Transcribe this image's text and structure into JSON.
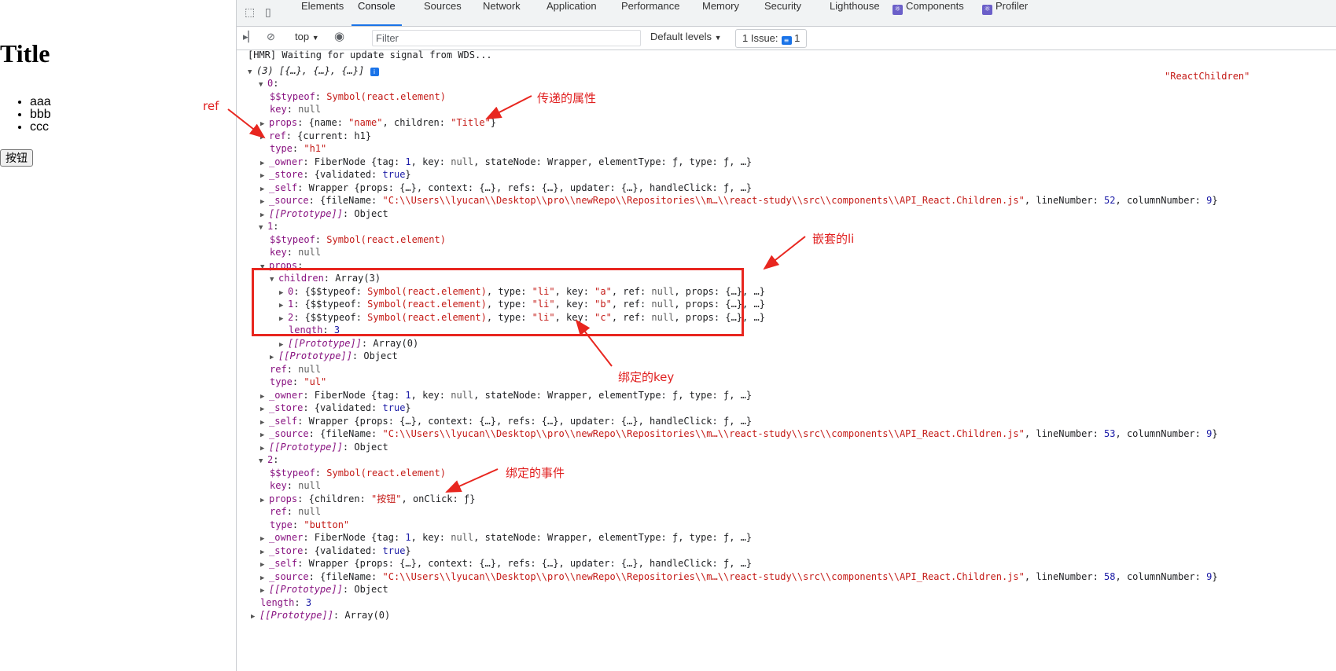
{
  "page": {
    "title": "Title",
    "list": [
      "aaa",
      "bbb",
      "ccc"
    ],
    "button": "按钮"
  },
  "devtools": {
    "tabs": [
      "Elements",
      "Console",
      "Sources",
      "Network",
      "Application",
      "Performance",
      "Memory",
      "Security",
      "Lighthouse",
      "Components",
      "Profiler"
    ],
    "active_tab": "Console",
    "context": "top",
    "filter_placeholder": "Filter",
    "levels": "Default levels",
    "issues_label": "1 Issue:",
    "issues_count": "1",
    "source_label": "\"ReactChildren\"",
    "accent_color": "#1a73e8"
  },
  "console_lines": [
    "[HMR] Waiting for update signal from WDS...",
    "(3) [{…}, {…}, {…}]",
    "0:",
    "$$typeof: Symbol(react.element)",
    "key: null",
    "props: {name: \"name\", children: \"Title\"}",
    "ref: {current: h1}",
    "type: \"h1\"",
    "_owner: FiberNode {tag: 1, key: null, stateNode: Wrapper, elementType: ƒ, type: ƒ, …}",
    "_store: {validated: true}",
    "_self: Wrapper {props: {…}, context: {…}, refs: {…}, updater: {…}, handleClick: ƒ, …}",
    "_source: {fileName: \"C:\\\\Users\\\\lyucan\\\\Desktop\\\\pro\\\\newRepo\\\\Repositories\\\\m…\\\\react-study\\\\src\\\\components\\\\API_React.Children.js\", lineNumber: 52, columnNumber: 9}",
    "[[Prototype]]: Object",
    "1:",
    "$$typeof: Symbol(react.element)",
    "key: null",
    "props:",
    "children: Array(3)",
    "0: {$$typeof: Symbol(react.element), type: \"li\", key: \"a\", ref: null, props: {…}, …}",
    "1: {$$typeof: Symbol(react.element), type: \"li\", key: \"b\", ref: null, props: {…}, …}",
    "2: {$$typeof: Symbol(react.element), type: \"li\", key: \"c\", ref: null, props: {…}, …}",
    "length: 3",
    "[[Prototype]]: Array(0)",
    "[[Prototype]]: Object",
    "ref: null",
    "type: \"ul\"",
    "_owner: FiberNode {tag: 1, key: null, stateNode: Wrapper, elementType: ƒ, type: ƒ, …}",
    "_store: {validated: true}",
    "_self: Wrapper {props: {…}, context: {…}, refs: {…}, updater: {…}, handleClick: ƒ, …}",
    "_source: {fileName: \"C:\\\\Users\\\\lyucan\\\\Desktop\\\\pro\\\\newRepo\\\\Repositories\\\\m…\\\\react-study\\\\src\\\\components\\\\API_React.Children.js\", lineNumber: 53, columnNumber: 9}",
    "[[Prototype]]: Object",
    "2:",
    "$$typeof: Symbol(react.element)",
    "key: null",
    "props: {children: \"按钮\", onClick: ƒ}",
    "ref: null",
    "type: \"button\"",
    "_owner: FiberNode {tag: 1, key: null, stateNode: Wrapper, elementType: ƒ, type: ƒ, …}",
    "_store: {validated: true}",
    "_self: Wrapper {props: {…}, context: {…}, refs: {…}, updater: {…}, handleClick: ƒ, …}",
    "_source: {fileName: \"C:\\\\Users\\\\lyucan\\\\Desktop\\\\pro\\\\newRepo\\\\Repositories\\\\m…\\\\react-study\\\\src\\\\components\\\\API_React.Children.js\", lineNumber: 58, columnNumber: 9}",
    "[[Prototype]]: Object",
    "length: 3",
    "[[Prototype]]: Array(0)"
  ],
  "annotations": {
    "ref": "ref",
    "props": "传递的属性",
    "nested": "嵌套的li",
    "key": "绑定的key",
    "event": "绑定的事件",
    "color": "#e02020"
  }
}
